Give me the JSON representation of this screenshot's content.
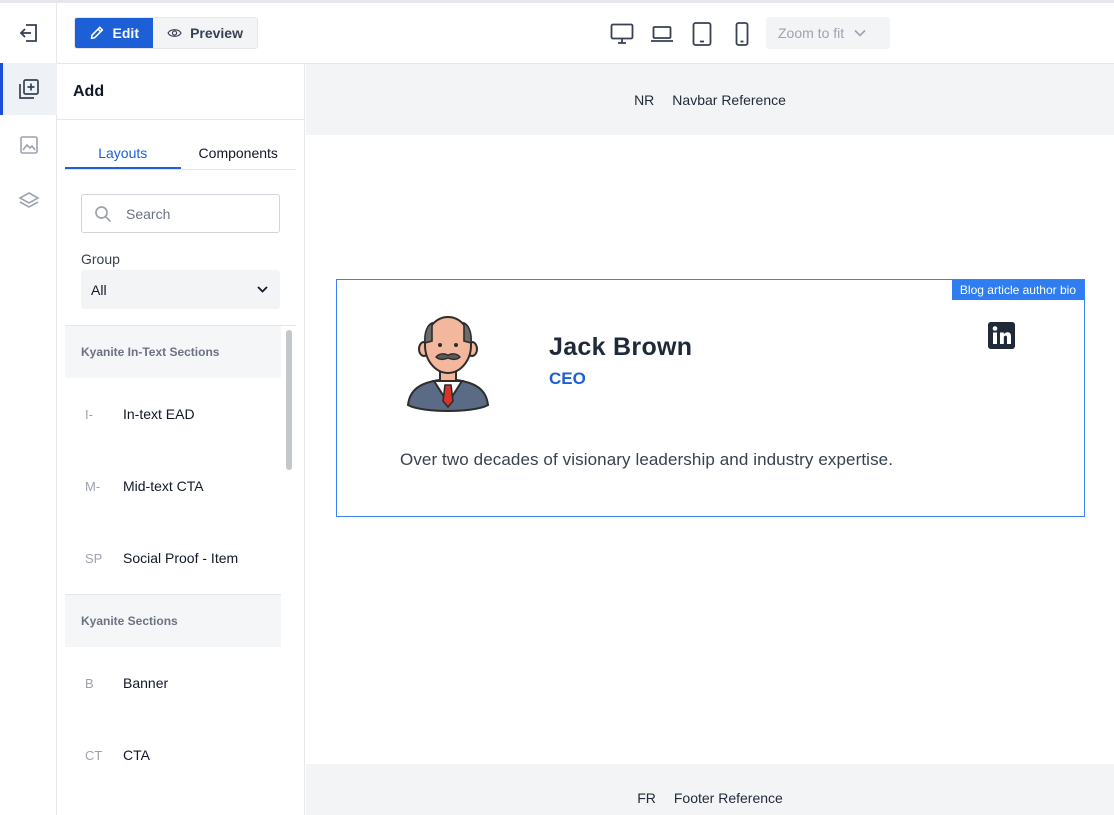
{
  "toolbar": {
    "edit_label": "Edit",
    "preview_label": "Preview",
    "zoom_label": "Zoom to fit",
    "devices": [
      "desktop-icon",
      "laptop-icon",
      "tablet-icon",
      "mobile-icon"
    ]
  },
  "rail": {
    "icons": [
      "exit-icon",
      "add-block-icon",
      "image-icon",
      "layers-icon"
    ]
  },
  "panel": {
    "title": "Add",
    "tabs": [
      "Layouts",
      "Components"
    ],
    "search_placeholder": "Search",
    "group_label": "Group",
    "group_value": "All",
    "sections": [
      {
        "header": "Kyanite In-Text Sections",
        "items": [
          {
            "abbr": "I-",
            "label": "In-text EAD"
          },
          {
            "abbr": "M-",
            "label": "Mid-text CTA"
          },
          {
            "abbr": "SP",
            "label": "Social Proof - Item"
          }
        ]
      },
      {
        "header": "Kyanite Sections",
        "items": [
          {
            "abbr": "B",
            "label": "Banner"
          },
          {
            "abbr": "CT",
            "label": "CTA"
          }
        ]
      }
    ]
  },
  "canvas": {
    "navbar_abbr": "NR",
    "navbar_label": "Navbar Reference",
    "footer_abbr": "FR",
    "footer_label": "Footer Reference",
    "bio": {
      "badge": "Blog article author bio",
      "name": "Jack Brown",
      "role": "CEO",
      "text": "Over two decades of visionary leadership and industry expertise."
    }
  },
  "colors": {
    "accent": "#1d5fd6",
    "selection": "#2f7df0"
  }
}
